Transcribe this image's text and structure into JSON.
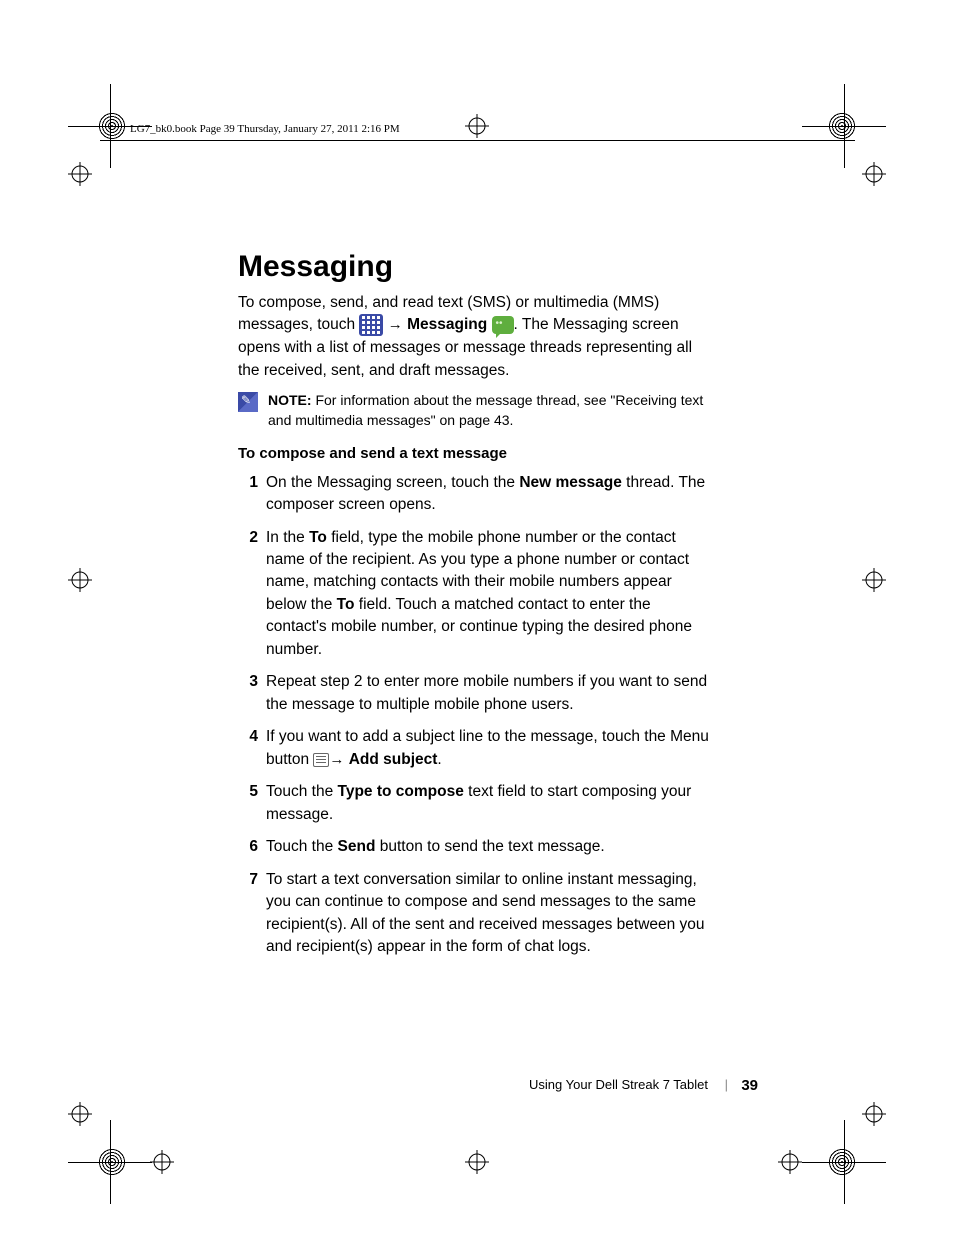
{
  "header": "LG7_bk0.book  Page 39  Thursday, January 27, 2011  2:16 PM",
  "title": "Messaging",
  "intro": {
    "part1": "To compose, send, and read text (SMS) or multimedia (MMS) messages, touch ",
    "arrow1": "→",
    "messaging_label": "Messaging",
    "part2": ". The Messaging screen opens with a list of messages or message threads representing all the received, sent, and draft messages."
  },
  "note": {
    "label": "NOTE:",
    "text": " For information about the message thread, see \"Receiving text and multimedia messages\" on page 43."
  },
  "subheading": "To compose and send a text message",
  "steps": {
    "s1a": "On the Messaging screen, touch the ",
    "s1b": "New message",
    "s1c": " thread. The composer screen opens.",
    "s2a": "In the ",
    "s2to1": "To",
    "s2b": " field, type the mobile phone number or the contact name of the recipient. As you type a phone number or contact name, matching contacts with their mobile numbers appear below the ",
    "s2to2": "To",
    "s2c": " field. Touch a matched contact to enter the contact's mobile number, or continue typing the desired phone number.",
    "s3": "Repeat step 2 to enter more mobile numbers if you want to send the message to multiple mobile phone users.",
    "s4a": "If you want to add a subject line to the message, touch the Menu button ",
    "s4arrow": "→",
    "s4b": "Add subject",
    "s4c": ".",
    "s5a": "Touch the ",
    "s5b": "Type to compose",
    "s5c": " text field to start composing your message.",
    "s6a": "Touch the ",
    "s6b": "Send",
    "s6c": " button to send the text message.",
    "s7": "To start a text conversation similar to online instant messaging, you can continue to compose and send messages to the same recipient(s). All of the sent and received messages between you and recipient(s) appear in the form of chat logs."
  },
  "footer": {
    "text": "Using Your Dell Streak 7 Tablet",
    "sep": "|",
    "page": "39"
  }
}
